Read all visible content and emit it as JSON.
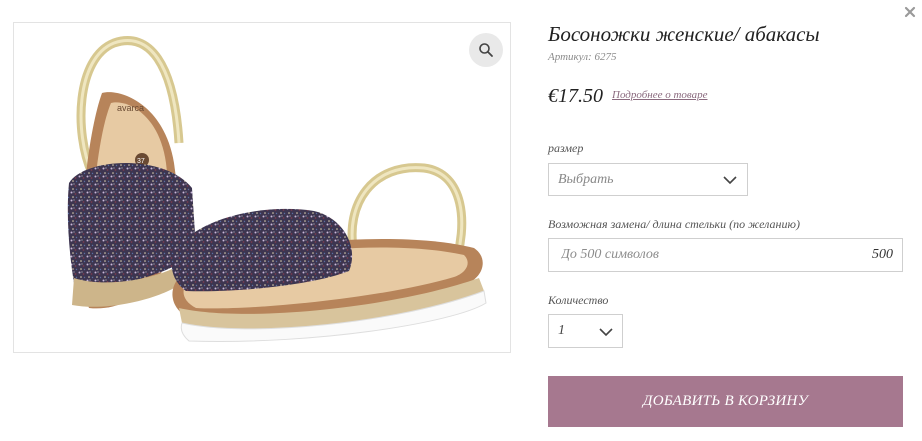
{
  "product": {
    "title": "Босоножки женские/ абакасы",
    "sku": "Артикул: 6275",
    "price": "€17.50",
    "details_link": "Подробнее о товаре",
    "image_brand_text": "avarca",
    "image_size_text": "37"
  },
  "size": {
    "label": "размер",
    "selected": "Выбрать"
  },
  "insole": {
    "label": "Возможная замена/ длина стельки (по желанию)",
    "placeholder": "До 500 символов",
    "counter": "500"
  },
  "quantity": {
    "label": "Количество",
    "selected": "1"
  },
  "add_to_cart_label": "ДОБАВИТЬ В КОРЗИНУ",
  "colors": {
    "accent": "#a6788f",
    "link": "#8a6a7e",
    "border": "#cfcfcf"
  },
  "icons": [
    "close-icon",
    "zoom-icon",
    "chevron-down-icon"
  ]
}
